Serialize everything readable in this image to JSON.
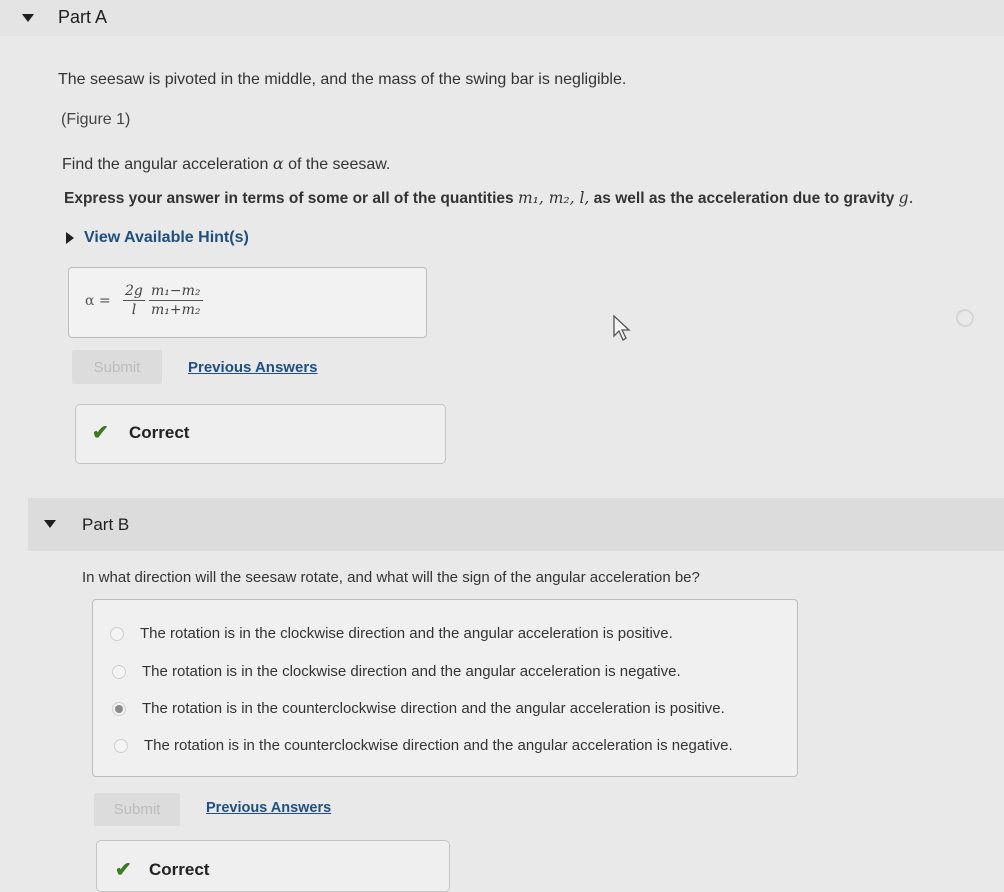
{
  "partA": {
    "title": "Part A",
    "intro": "The seesaw is pivoted in the middle, and the mass of the swing bar is negligible.",
    "figure_link": "(Figure 1)",
    "prompt_prefix": "Find the angular acceleration",
    "prompt_symbol": "α",
    "prompt_suffix": "of the seesaw.",
    "instruction_prefix": "Express your answer in terms of some or all of the quantities",
    "instruction_vars": "m₁, m₂, l,",
    "instruction_suffix": "as well as the acceleration due to gravity",
    "instruction_g": "g.",
    "hint_label": "View Available Hint(s)",
    "answer_lhs": "α =",
    "answer_frac1_num": "2g",
    "answer_frac1_den": "l",
    "answer_frac2_num": "m₁−m₂",
    "answer_frac2_den": "m₁+m₂",
    "submit_label": "Submit",
    "previous_answers_label": "Previous Answers",
    "correct_label": "Correct"
  },
  "partB": {
    "title": "Part B",
    "question": "In what direction will the seesaw rotate, and what will the sign of the angular acceleration be?",
    "options": [
      "The rotation is in the clockwise direction and the angular acceleration is positive.",
      "The rotation is in the clockwise direction and the angular acceleration is negative.",
      "The rotation is in the counterclockwise direction and the angular acceleration is positive.",
      "The rotation is in the counterclockwise direction and the angular acceleration is negative."
    ],
    "selected_index": 2,
    "submit_label": "Submit",
    "previous_answers_label": "Previous Answers",
    "correct_label": "Correct"
  }
}
